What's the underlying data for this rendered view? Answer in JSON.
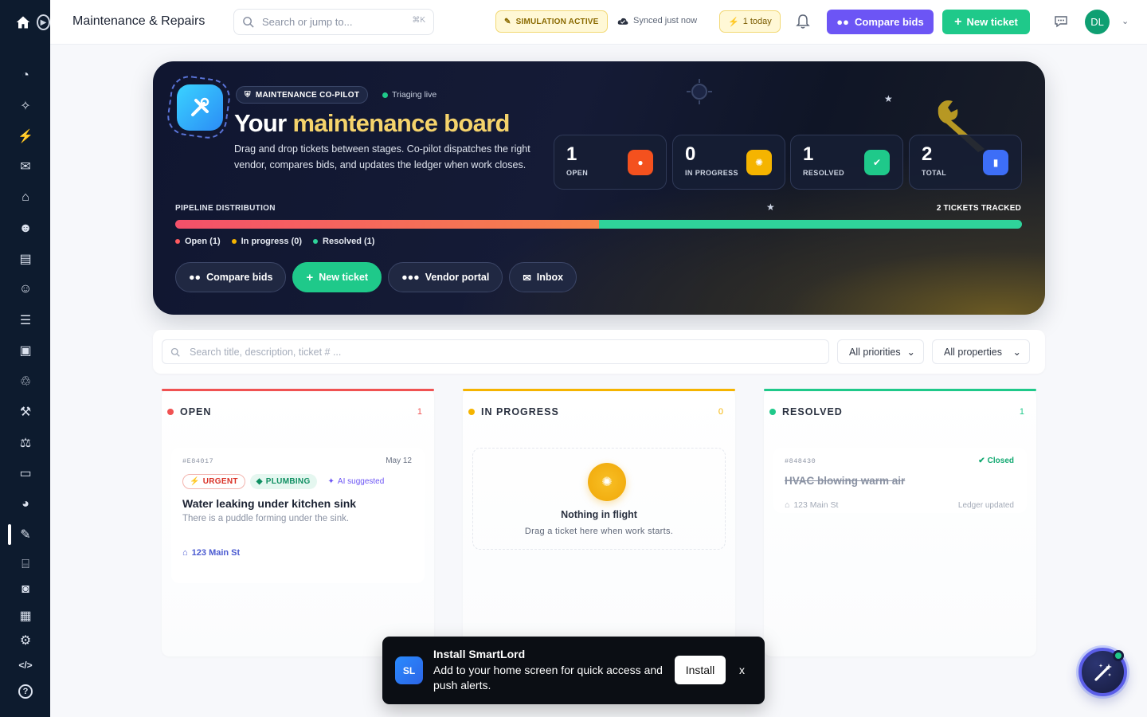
{
  "app": {
    "title": "Maintenance & Repairs"
  },
  "search": {
    "placeholder": "Search or jump to...",
    "shortcut": "⌘K"
  },
  "status": {
    "simulation": "SIMULATION ACTIVE",
    "synced": "Synced just now",
    "today": "1 today"
  },
  "topbar": {
    "compare_label": "Compare bids",
    "new_ticket_label": "New ticket",
    "avatar_initials": "DL"
  },
  "sidebar": {
    "icons": [
      "dashboard-pie-icon",
      "magic-wand-icon",
      "bolt-icon",
      "mail-icon",
      "home-icon",
      "users-icon",
      "document-icon",
      "add-user-icon",
      "list-icon",
      "money-icon",
      "handshake-icon",
      "hammer-icon",
      "scale-icon",
      "wallet-icon",
      "chart-pie-icon",
      "wrench-icon",
      "bank-icon",
      "id-card-icon",
      "receipt-icon",
      "settings-icon",
      "code-icon",
      "help-icon"
    ],
    "active": "wrench-icon"
  },
  "hero": {
    "badge": "MAINTENANCE CO-PILOT",
    "live": "Triaging live",
    "title_prefix": "Your",
    "title_accent": "maintenance board",
    "description": "Drag and drop tickets between stages. Co-pilot dispatches the right vendor, compares bids, and updates the ledger when work closes.",
    "stats": [
      {
        "value": "1",
        "label": "OPEN",
        "color": "#f4511e"
      },
      {
        "value": "0",
        "label": "IN PROGRESS",
        "color": "#f5b400"
      },
      {
        "value": "1",
        "label": "RESOLVED",
        "color": "#1fc98a"
      },
      {
        "value": "2",
        "label": "TOTAL",
        "color": "#3d6ef7"
      }
    ],
    "pipeline_label": "PIPELINE DISTRIBUTION",
    "pipeline_total": "2 TICKETS TRACKED",
    "pipeline": [
      {
        "name": "Open",
        "share": 0.5,
        "color": "#f4634a"
      },
      {
        "name": "In progress",
        "share": 0,
        "color": "#f5b400"
      },
      {
        "name": "Resolved",
        "share": 0.5,
        "color": "#2fd39a"
      }
    ],
    "legend": [
      "Open (1)",
      "In progress (0)",
      "Resolved (1)"
    ],
    "legend_colors": [
      "#ff5a5f",
      "#f5b400",
      "#2fd39a"
    ],
    "actions": [
      "Compare bids",
      "New ticket",
      "Vendor portal",
      "Inbox"
    ]
  },
  "filters": {
    "search_placeholder": "Search title, description, ticket # ...",
    "priority": "All priorities",
    "property": "All properties"
  },
  "columns": [
    {
      "title": "OPEN",
      "count": "1",
      "color": "#f05252"
    },
    {
      "title": "IN PROGRESS",
      "count": "0",
      "color": "#f5b400"
    },
    {
      "title": "RESOLVED",
      "count": "1",
      "color": "#1fc98a"
    }
  ],
  "open_ticket": {
    "id": "#E84017",
    "date": "May 12",
    "tags": [
      "URGENT",
      "PLUMBING",
      "AI suggested"
    ],
    "title": "Water leaking under kitchen sink",
    "description": "There is a puddle forming under the sink.",
    "property": "123 Main St"
  },
  "empty_state": {
    "title": "Nothing in flight",
    "subtitle": "Drag a ticket here when work starts."
  },
  "resolved_ticket": {
    "id": "#848430",
    "status": "Closed",
    "title": "HVAC blowing warm air",
    "property": "123 Main St",
    "note": "Ledger updated"
  },
  "toast": {
    "logo": "SL",
    "title": "Install SmartLord",
    "text": "Add to your home screen for quick access and push alerts.",
    "install": "Install",
    "close": "x"
  }
}
